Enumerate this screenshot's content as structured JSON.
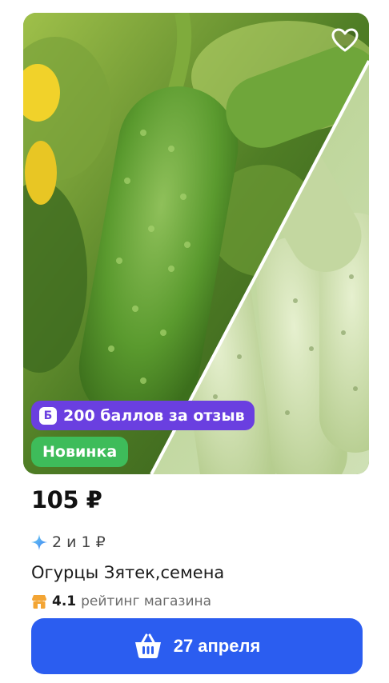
{
  "product": {
    "favorite_icon": "heart-outline-icon",
    "points_badge": {
      "icon": "b-coin-icon",
      "label": "200 баллов за отзыв"
    },
    "new_badge": "Новинка",
    "price": "105 ₽",
    "split": {
      "icon": "sparkle-icon",
      "text": "2 и 1 ₽"
    },
    "name": "Огурцы Зятек,семена",
    "rating": {
      "icon": "shop-icon",
      "value": "4.1",
      "label": "рейтинг магазина"
    },
    "cta": {
      "icon": "basket-icon",
      "label": "27 апреля"
    }
  },
  "colors": {
    "accent": "#2b5df0",
    "points_badge": "#6a3fe0",
    "new_badge": "#3ebc5a",
    "rating_icon": "#f3a534"
  }
}
